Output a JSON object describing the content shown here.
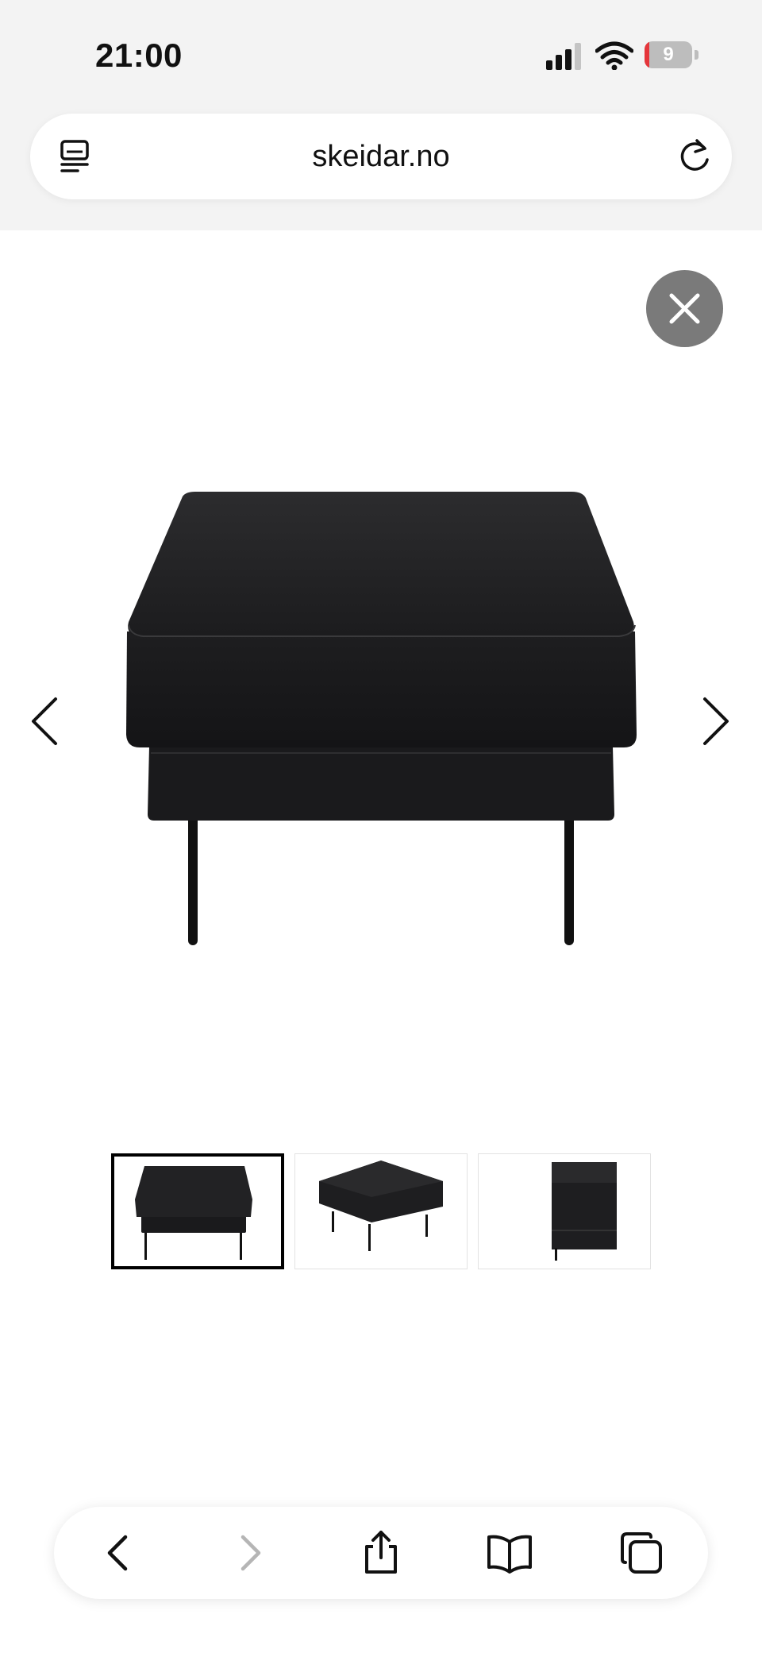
{
  "status_bar": {
    "time": "21:00",
    "battery_level": "9",
    "battery_fraction": 0.09,
    "icons": [
      "signal-icon",
      "wifi-icon",
      "battery-icon"
    ]
  },
  "browser": {
    "url": "skeidar.no",
    "left_icon": "reader-icon",
    "right_icon": "reload-icon"
  },
  "gallery": {
    "close_icon": "close-icon",
    "prev_icon": "chevron-left-icon",
    "next_icon": "chevron-right-icon",
    "thumbnails": [
      {
        "view": "front",
        "active": true
      },
      {
        "view": "angle",
        "active": false
      },
      {
        "view": "side",
        "active": false
      }
    ]
  },
  "toolbar": {
    "items": [
      "back-icon",
      "forward-icon",
      "share-icon",
      "bookmarks-icon",
      "tabs-icon"
    ]
  },
  "colors": {
    "chrome_bg": "#f3f3f3",
    "close_button_bg": "#7a7a7a",
    "battery_red": "#e5363b",
    "product": "#1d1d1f"
  }
}
